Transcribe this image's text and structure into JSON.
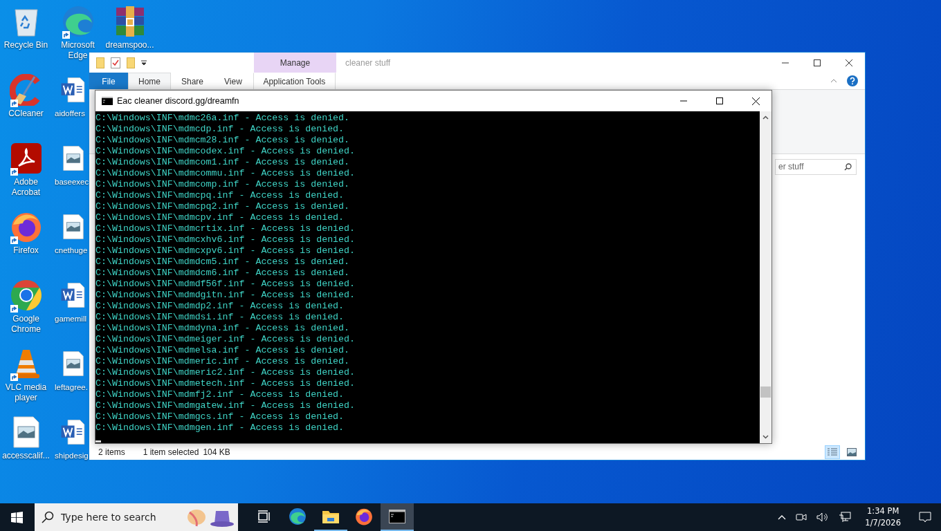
{
  "desktop_icons": [
    {
      "label": "Recycle Bin",
      "kind": "recycle-bin",
      "shortcut": false
    },
    {
      "label": "CCleaner",
      "kind": "ccleaner",
      "shortcut": true
    },
    {
      "label": "Adobe Acrobat",
      "kind": "pdf",
      "shortcut": true
    },
    {
      "label": "Firefox",
      "kind": "firefox",
      "shortcut": true
    },
    {
      "label": "Google Chrome",
      "kind": "chrome",
      "shortcut": true
    },
    {
      "label": "VLC media player",
      "kind": "vlc",
      "shortcut": true
    },
    {
      "label": "accesscalif...",
      "kind": "image-doc",
      "shortcut": false
    },
    {
      "label": "Microsoft Edge",
      "kind": "edge",
      "shortcut": true
    },
    {
      "label": "aidoffers",
      "kind": "word-doc",
      "shortcut": false
    },
    {
      "label": "baseexec",
      "kind": "image-doc",
      "shortcut": false
    },
    {
      "label": "cnethuge",
      "kind": "image-doc",
      "shortcut": false
    },
    {
      "label": "gamemill",
      "kind": "word-doc",
      "shortcut": false
    },
    {
      "label": "leftagree.",
      "kind": "image-doc",
      "shortcut": false
    },
    {
      "label": "shipdesig",
      "kind": "word-doc",
      "shortcut": false
    },
    {
      "label": "dreamspoo...",
      "kind": "archive",
      "shortcut": false
    }
  ],
  "explorer": {
    "title": "cleaner stuff",
    "context_group": "Manage",
    "tabs": [
      {
        "label": "File",
        "kind": "file",
        "selected": false
      },
      {
        "label": "Home",
        "kind": "tab",
        "selected": true
      },
      {
        "label": "Share",
        "kind": "tab",
        "selected": false
      },
      {
        "label": "View",
        "kind": "tab",
        "selected": false
      },
      {
        "label": "Application Tools",
        "kind": "context",
        "selected": false
      }
    ],
    "search": {
      "placeholder": "er stuff"
    },
    "status": {
      "count": "2 items",
      "selection": "1 item selected",
      "size": "104 KB"
    },
    "view_buttons": [
      {
        "kind": "details",
        "selected": true
      },
      {
        "kind": "large-icons",
        "selected": false
      }
    ]
  },
  "console": {
    "title": "Eac cleaner discord.gg/dreamfn",
    "lines": [
      "C:\\Windows\\INF\\mdmc26a.inf - Access is denied.",
      "C:\\Windows\\INF\\mdmcdp.inf - Access is denied.",
      "C:\\Windows\\INF\\mdmcm28.inf - Access is denied.",
      "C:\\Windows\\INF\\mdmcodex.inf - Access is denied.",
      "C:\\Windows\\INF\\mdmcom1.inf - Access is denied.",
      "C:\\Windows\\INF\\mdmcommu.inf - Access is denied.",
      "C:\\Windows\\INF\\mdmcomp.inf - Access is denied.",
      "C:\\Windows\\INF\\mdmcpq.inf - Access is denied.",
      "C:\\Windows\\INF\\mdmcpq2.inf - Access is denied.",
      "C:\\Windows\\INF\\mdmcpv.inf - Access is denied.",
      "C:\\Windows\\INF\\mdmcrtix.inf - Access is denied.",
      "C:\\Windows\\INF\\mdmcxhv6.inf - Access is denied.",
      "C:\\Windows\\INF\\mdmcxpv6.inf - Access is denied.",
      "C:\\Windows\\INF\\mdmdcm5.inf - Access is denied.",
      "C:\\Windows\\INF\\mdmdcm6.inf - Access is denied.",
      "C:\\Windows\\INF\\mdmdf56f.inf - Access is denied.",
      "C:\\Windows\\INF\\mdmdgitn.inf - Access is denied.",
      "C:\\Windows\\INF\\mdmdp2.inf - Access is denied.",
      "C:\\Windows\\INF\\mdmdsi.inf - Access is denied.",
      "C:\\Windows\\INF\\mdmdyna.inf - Access is denied.",
      "C:\\Windows\\INF\\mdmeiger.inf - Access is denied.",
      "C:\\Windows\\INF\\mdmelsa.inf - Access is denied.",
      "C:\\Windows\\INF\\mdmeric.inf - Access is denied.",
      "C:\\Windows\\INF\\mdmeric2.inf - Access is denied.",
      "C:\\Windows\\INF\\mdmetech.inf - Access is denied.",
      "C:\\Windows\\INF\\mdmfj2.inf - Access is denied.",
      "C:\\Windows\\INF\\mdmgatew.inf - Access is denied.",
      "C:\\Windows\\INF\\mdmgcs.inf - Access is denied.",
      "C:\\Windows\\INF\\mdmgen.inf - Access is denied."
    ]
  },
  "taskbar": {
    "search_placeholder": "Type here to search",
    "apps": [
      {
        "kind": "task-view",
        "running": false,
        "selected": false
      },
      {
        "kind": "edge",
        "running": false,
        "selected": false
      },
      {
        "kind": "explorer",
        "running": true,
        "selected": false
      },
      {
        "kind": "firefox",
        "running": false,
        "selected": false
      },
      {
        "kind": "console",
        "running": true,
        "selected": true
      }
    ],
    "time": "1:34 PM",
    "date": "1/7/2026"
  }
}
